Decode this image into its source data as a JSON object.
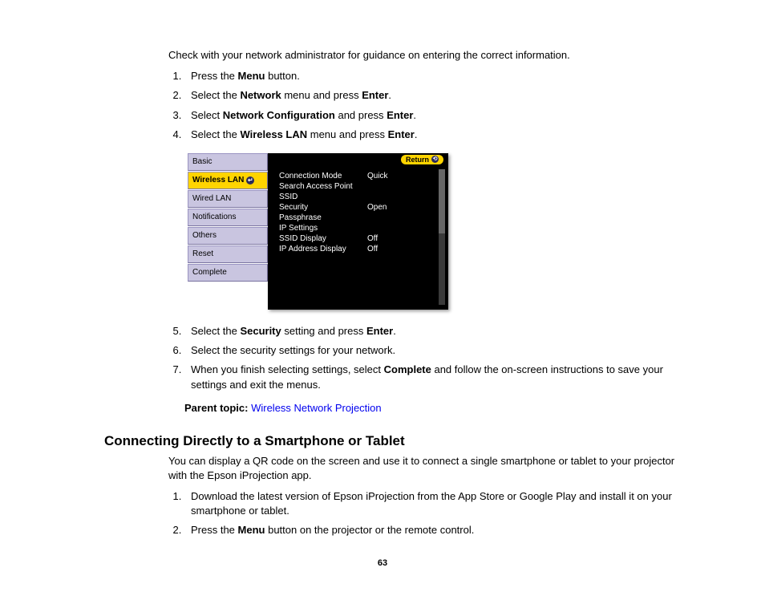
{
  "intro": "Check with your network administrator for guidance on entering the correct information.",
  "steps1": {
    "s1_a": "Press the ",
    "s1_b": "Menu",
    "s1_c": " button.",
    "s2_a": "Select the ",
    "s2_b": "Network",
    "s2_c": " menu and press ",
    "s2_d": "Enter",
    "s2_e": ".",
    "s3_a": "Select ",
    "s3_b": "Network Configuration",
    "s3_c": " and press ",
    "s3_d": "Enter",
    "s3_e": ".",
    "s4_a": "Select the ",
    "s4_b": "Wireless LAN",
    "s4_c": " menu and press ",
    "s4_d": "Enter",
    "s4_e": "."
  },
  "menu": {
    "tabs": {
      "t0": "Basic",
      "t1": "Wireless LAN",
      "t2": "Wired LAN",
      "t3": "Notifications",
      "t4": "Others",
      "t5": "Reset",
      "t6": "Complete"
    },
    "return": "Return",
    "settings": {
      "r0": {
        "label": "Connection Mode",
        "value": "Quick"
      },
      "r1": {
        "label": "Search Access Point",
        "value": ""
      },
      "r2": {
        "label": "SSID",
        "value": ""
      },
      "r3": {
        "label": "Security",
        "value": "Open"
      },
      "r4": {
        "label": "Passphrase",
        "value": ""
      },
      "r5": {
        "label": "IP Settings",
        "value": ""
      },
      "r6": {
        "label": "SSID Display",
        "value": "Off"
      },
      "r7": {
        "label": "IP Address Display",
        "value": "Off"
      }
    }
  },
  "steps2": {
    "s5_a": "Select the ",
    "s5_b": "Security",
    "s5_c": " setting and press ",
    "s5_d": "Enter",
    "s5_e": ".",
    "s6": "Select the security settings for your network.",
    "s7_a": "When you finish selecting settings, select ",
    "s7_b": "Complete",
    "s7_c": " and follow the on-screen instructions to save your settings and exit the menus."
  },
  "parent": {
    "label": "Parent topic:",
    "link": "Wireless Network Projection"
  },
  "h2": "Connecting Directly to a Smartphone or Tablet",
  "p2": "You can display a QR code on the screen and use it to connect a single smartphone or tablet to your projector with the Epson iProjection app.",
  "steps3": {
    "s1": "Download the latest version of Epson iProjection from the App Store or Google Play and install it on your smartphone or tablet.",
    "s2_a": "Press the ",
    "s2_b": "Menu",
    "s2_c": " button on the projector or the remote control."
  },
  "pagenum": "63"
}
